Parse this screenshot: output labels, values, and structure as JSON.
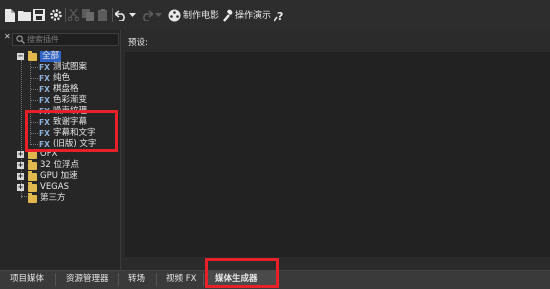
{
  "toolbar": {
    "make_movie_label": "制作电影",
    "tutorial_label": "操作演示"
  },
  "sidebar": {
    "search_placeholder": "搜索插件",
    "tree": {
      "root_label": "全部",
      "fx_badge": "FX",
      "generators": [
        {
          "label": "测试图案"
        },
        {
          "label": "纯色"
        },
        {
          "label": "棋盘格"
        },
        {
          "label": "色彩渐变"
        },
        {
          "label": "噪声纹理"
        },
        {
          "label": "致谢字幕"
        },
        {
          "label": "字幕和文字"
        },
        {
          "label": "(旧版) 文字"
        }
      ],
      "groups": [
        {
          "label": "OFX",
          "expander": "+"
        },
        {
          "label": "32 位浮点",
          "expander": "+"
        },
        {
          "label": "GPU 加速",
          "expander": "+"
        },
        {
          "label": "VEGAS",
          "expander": "+"
        },
        {
          "label": "第三方",
          "expander": ""
        }
      ],
      "root_expander": "−"
    }
  },
  "main": {
    "preset_label": "预设:"
  },
  "tabs": [
    {
      "label": "项目媒体"
    },
    {
      "label": "资源管理器"
    },
    {
      "label": "转场"
    },
    {
      "label": "视频 FX"
    },
    {
      "label": "媒体生成器"
    }
  ],
  "colors": {
    "annotation_red": "#e8202a",
    "folder_yellow": "#e0b84e",
    "fx_blue": "#8fb0d8"
  }
}
